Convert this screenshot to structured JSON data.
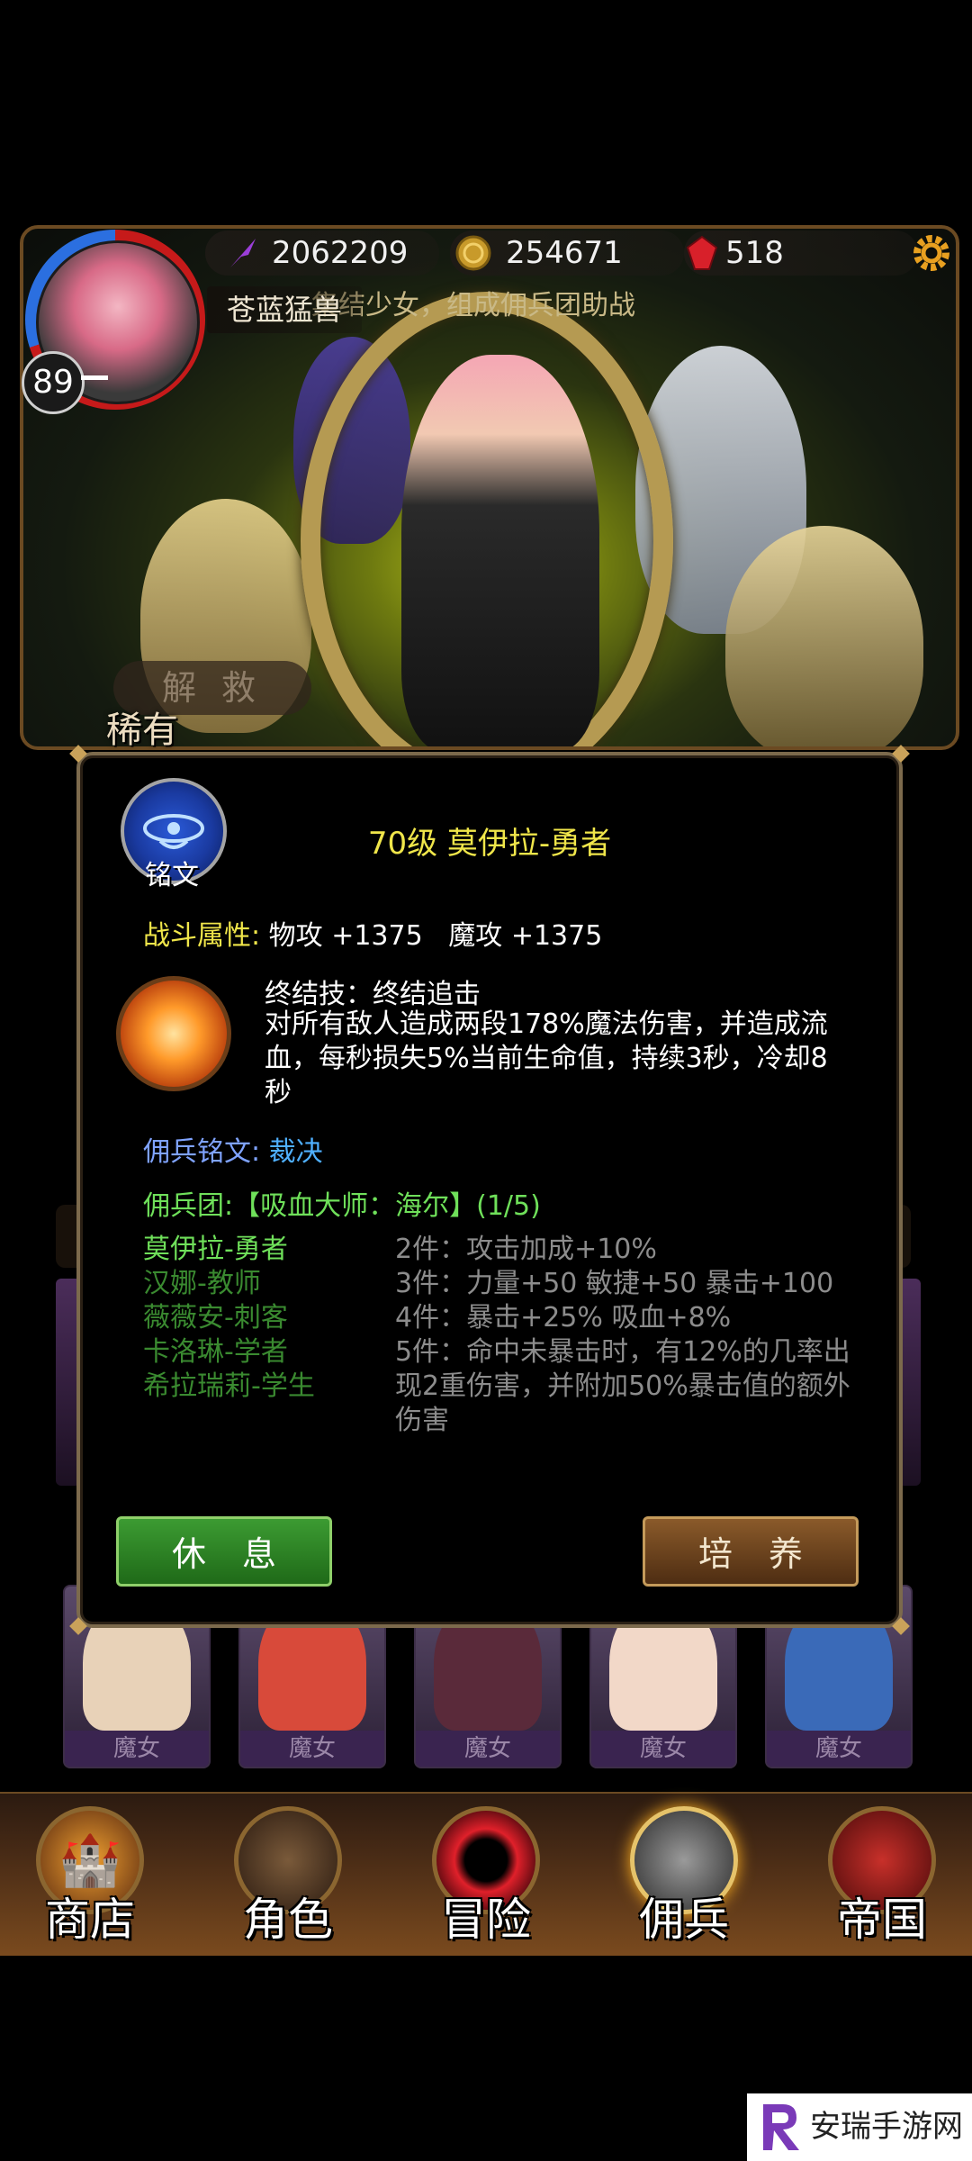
{
  "top_bar": {
    "level": "89",
    "player_name": "苍蓝猛兽",
    "currencies": [
      {
        "icon": "purple-feather-icon",
        "value": "2062209"
      },
      {
        "icon": "gold-coin-icon",
        "value": "254671"
      },
      {
        "icon": "red-gem-icon",
        "value": "518"
      }
    ]
  },
  "banner": {
    "slogan": "集结少女，组成佣兵团助战",
    "rescue_label": "解救",
    "rarity": "稀有"
  },
  "dialog": {
    "inscription_label": "铭文",
    "title": "70级 莫伊拉-勇者",
    "stats_label": "战斗属性:",
    "stats_values": "物攻 +1375   魔攻 +1375",
    "skill_title": "终结技：终结追击",
    "skill_desc": "对所有敌人造成两段178%魔法伤害，并造成流血，每秒损失5%当前生命值，持续3秒，冷却8秒",
    "merc_inscription_label": "佣兵铭文:",
    "merc_inscription_value": "裁决",
    "legion_label": "佣兵团:",
    "legion_name": "【吸血大师：海尔】",
    "legion_count": "(1/5)",
    "members": [
      {
        "name": "莫伊拉-勇者",
        "active": true
      },
      {
        "name": "汉娜-教师",
        "active": false
      },
      {
        "name": "薇薇安-刺客",
        "active": false
      },
      {
        "name": "卡洛琳-学者",
        "active": false
      },
      {
        "name": "希拉瑞莉-学生",
        "active": false
      }
    ],
    "bonuses": [
      "2件：攻击加成+10%",
      "3件：力量+50 敏捷+50 暴击+100",
      "4件：暴击+25% 吸血+8%",
      "5件：命中未暴击时，有12%的几率出现2重伤害，并附加50%暴击值的额外伤害"
    ],
    "rest_button": "休息",
    "train_button": "培养"
  },
  "grid": {
    "cards": [
      {
        "class": "魔女",
        "color": "#e8d2b8"
      },
      {
        "class": "魔女",
        "color": "#d84a3a"
      },
      {
        "class": "魔女",
        "color": "#5a2a3a"
      },
      {
        "class": "魔女",
        "color": "#f2d8c8"
      },
      {
        "class": "魔女",
        "color": "#3a6ab8"
      }
    ]
  },
  "bottom_nav": [
    {
      "label": "商店",
      "icon": "shop-castle-icon",
      "active": false
    },
    {
      "label": "角色",
      "icon": "hooded-figure-icon",
      "active": false
    },
    {
      "label": "冒险",
      "icon": "red-portal-icon",
      "active": false
    },
    {
      "label": "佣兵",
      "icon": "mercenary-portrait-icon",
      "active": true
    },
    {
      "label": "帝国",
      "icon": "empire-banner-icon",
      "active": false
    }
  ],
  "watermark": "安瑞手游网",
  "colors": {
    "title_yellow": "#f0e64a",
    "legion_green": "#6fe05a",
    "inscription_blue": "#7fa3ff",
    "rest_green": "#2e8a26",
    "train_brown": "#7a4a22"
  }
}
